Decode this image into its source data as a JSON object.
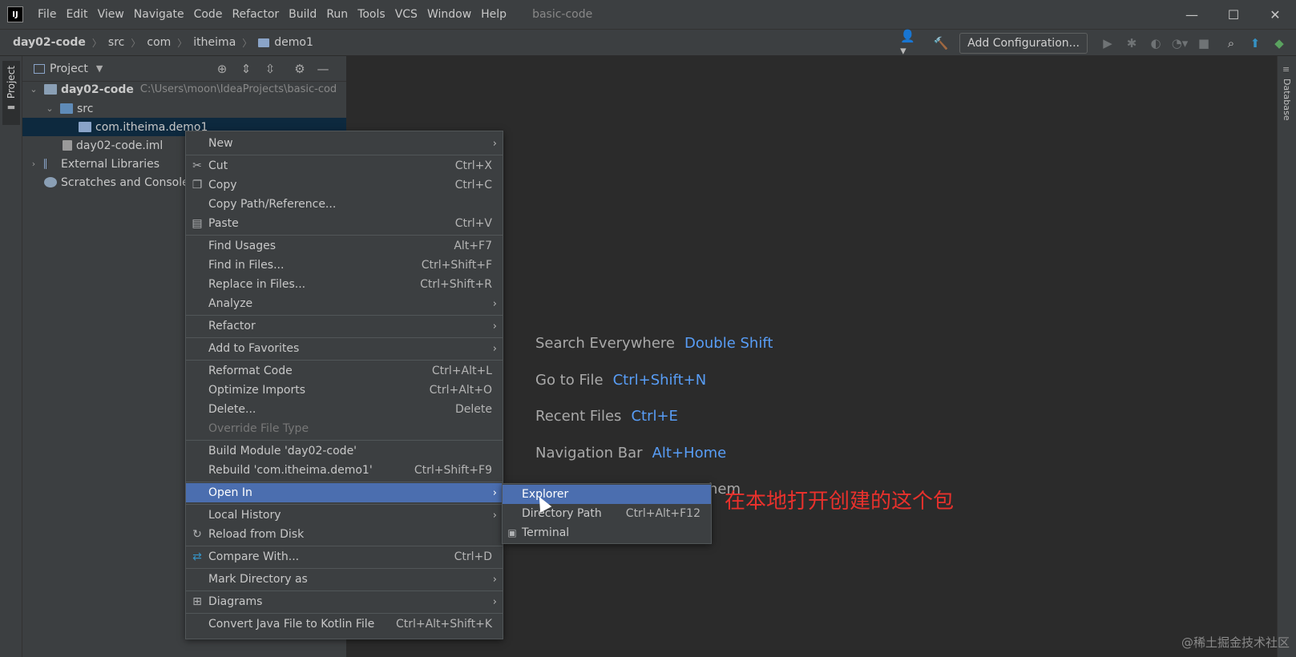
{
  "titlebar": {
    "logo": "IJ",
    "menu": [
      "File",
      "Edit",
      "View",
      "Navigate",
      "Code",
      "Refactor",
      "Build",
      "Run",
      "Tools",
      "VCS",
      "Window",
      "Help"
    ],
    "project_name": "basic-code"
  },
  "navbar": {
    "crumbs": [
      "day02-code",
      "src",
      "com",
      "itheima",
      "demo1"
    ],
    "add_configuration": "Add Configuration..."
  },
  "stripes": {
    "left": "Project",
    "right": "Database"
  },
  "project_panel": {
    "title": "Project",
    "tree": [
      {
        "label": "day02-code",
        "hint": "C:\\Users\\moon\\IdeaProjects\\basic-cod"
      },
      {
        "label": "src"
      },
      {
        "label": "com.itheima.demo1"
      },
      {
        "label": "day02-code.iml"
      },
      {
        "label": "External Libraries"
      },
      {
        "label": "Scratches and Console"
      }
    ]
  },
  "editor_hints": [
    {
      "label": "Search Everywhere",
      "key": "Double Shift"
    },
    {
      "label": "Go to File",
      "key": "Ctrl+Shift+N"
    },
    {
      "label": "Recent Files",
      "key": "Ctrl+E"
    },
    {
      "label": "Navigation Bar",
      "key": "Alt+Home"
    },
    {
      "label": "hem",
      "key": ""
    }
  ],
  "context_menu": {
    "items": [
      {
        "label": "New",
        "shortcut": "",
        "submenu": true
      },
      {
        "label": "Cut",
        "shortcut": "Ctrl+X",
        "icon": "scissors-icon"
      },
      {
        "label": "Copy",
        "shortcut": "Ctrl+C",
        "icon": "copy-icon"
      },
      {
        "label": "Copy Path/Reference...",
        "shortcut": ""
      },
      {
        "label": "Paste",
        "shortcut": "Ctrl+V",
        "icon": "clipboard-icon"
      },
      {
        "label": "Find Usages",
        "shortcut": "Alt+F7"
      },
      {
        "label": "Find in Files...",
        "shortcut": "Ctrl+Shift+F"
      },
      {
        "label": "Replace in Files...",
        "shortcut": "Ctrl+Shift+R"
      },
      {
        "label": "Analyze",
        "shortcut": "",
        "submenu": true
      },
      {
        "label": "Refactor",
        "shortcut": "",
        "submenu": true
      },
      {
        "label": "Add to Favorites",
        "shortcut": "",
        "submenu": true
      },
      {
        "label": "Reformat Code",
        "shortcut": "Ctrl+Alt+L"
      },
      {
        "label": "Optimize Imports",
        "shortcut": "Ctrl+Alt+O"
      },
      {
        "label": "Delete...",
        "shortcut": "Delete"
      },
      {
        "label": "Override File Type",
        "shortcut": "",
        "disabled": true
      },
      {
        "label": "Build Module 'day02-code'",
        "shortcut": ""
      },
      {
        "label": "Rebuild 'com.itheima.demo1'",
        "shortcut": "Ctrl+Shift+F9"
      },
      {
        "label": "Open In",
        "shortcut": "",
        "submenu": true,
        "active": true
      },
      {
        "label": "Local History",
        "shortcut": "",
        "submenu": true
      },
      {
        "label": "Reload from Disk",
        "shortcut": "",
        "icon": "reload-icon"
      },
      {
        "label": "Compare With...",
        "shortcut": "Ctrl+D",
        "icon": "compare-icon"
      },
      {
        "label": "Mark Directory as",
        "shortcut": "",
        "submenu": true
      },
      {
        "label": "Diagrams",
        "shortcut": "",
        "submenu": true,
        "icon": "diagram-icon"
      },
      {
        "label": "Convert Java File to Kotlin File",
        "shortcut": "Ctrl+Alt+Shift+K"
      }
    ]
  },
  "submenu": {
    "items": [
      {
        "label": "Explorer",
        "shortcut": "",
        "active": true
      },
      {
        "label": "Directory Path",
        "shortcut": "Ctrl+Alt+F12"
      },
      {
        "label": "Terminal",
        "shortcut": "",
        "icon": "terminal-icon"
      }
    ]
  },
  "annotation": "在本地打开创建的这个包",
  "watermark": "@稀土掘金技术社区",
  "colors": {
    "accent": "#4b6eaf",
    "link": "#589df6",
    "annotation": "#e8312c"
  }
}
